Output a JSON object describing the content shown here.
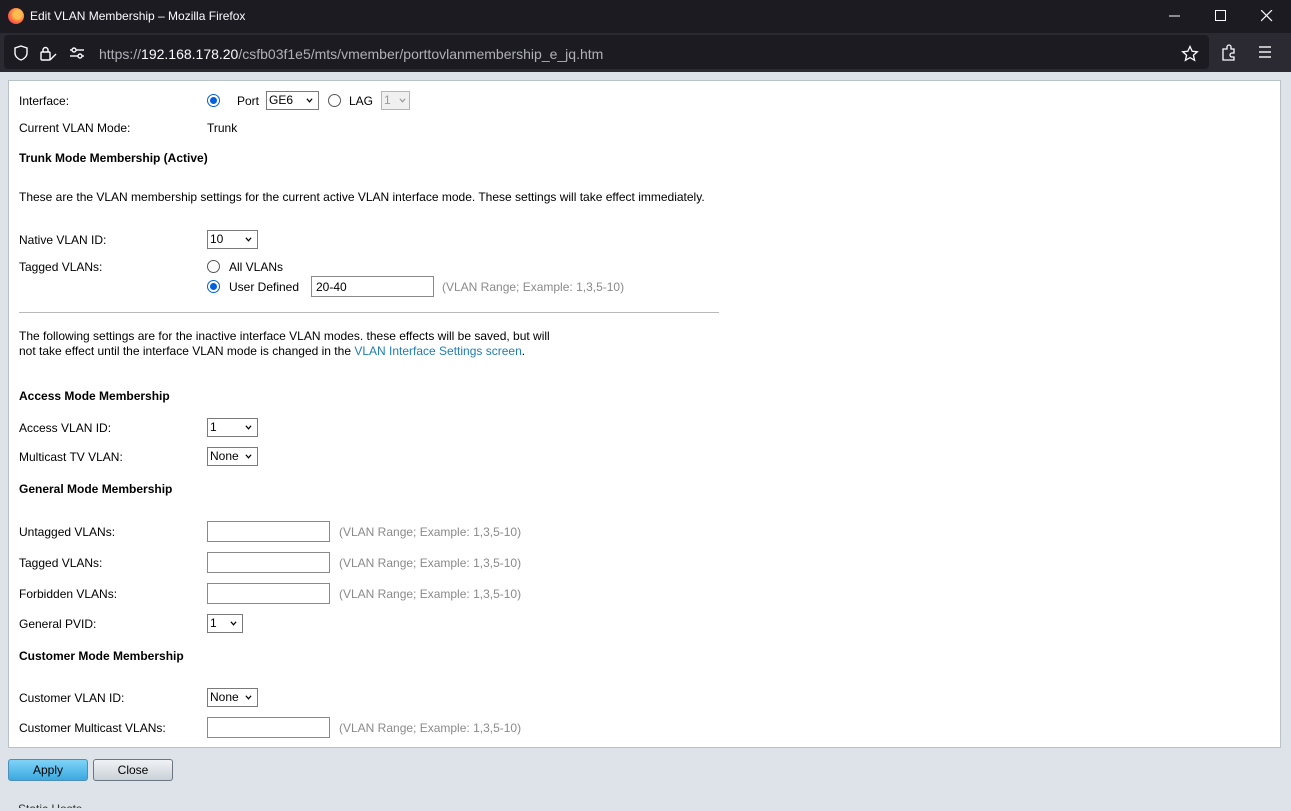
{
  "window": {
    "title": "Edit VLAN Membership – Mozilla Firefox"
  },
  "urlbar": {
    "url_prefix": "https://",
    "url_host": "192.168.178.20",
    "url_path": "/csfb03f1e5/mts/vmember/porttovlanmembership_e_jq.htm"
  },
  "form": {
    "interface_label": "Interface:",
    "port_label": "Port",
    "port_value": "GE6",
    "lag_label": "LAG",
    "lag_value": "1",
    "current_mode_label": "Current VLAN Mode:",
    "current_mode_value": "Trunk",
    "trunk": {
      "heading": "Trunk Mode Membership (Active)",
      "description": "These are the VLAN membership settings for the current active VLAN interface mode. These settings will take effect immediately.",
      "native_label": "Native VLAN ID:",
      "native_value": "10",
      "tagged_label": "Tagged VLANs:",
      "all_vlans_label": "All VLANs",
      "user_defined_label": "User Defined",
      "user_defined_value": "20-40",
      "range_hint": "(VLAN Range; Example: 1,3,5-10)"
    },
    "inactive_note_line1": "The following settings are for the inactive interface VLAN modes. these effects will be saved, but will",
    "inactive_note_line2_prefix": "not take effect until the interface VLAN mode is changed in the ",
    "inactive_note_link": "VLAN Interface Settings screen",
    "inactive_note_suffix": ".",
    "access": {
      "heading": "Access Mode Membership",
      "vlan_label": "Access VLAN ID:",
      "vlan_value": "1",
      "mtv_label": "Multicast TV VLAN:",
      "mtv_value": "None"
    },
    "general": {
      "heading": "General Mode Membership",
      "untagged_label": "Untagged VLANs:",
      "tagged_label": "Tagged VLANs:",
      "forbidden_label": "Forbidden VLANs:",
      "pvid_label": "General PVID:",
      "pvid_value": "1",
      "range_hint": "(VLAN Range; Example: 1,3,5-10)"
    },
    "customer": {
      "heading": "Customer Mode Membership",
      "vlan_label": "Customer VLAN ID:",
      "vlan_value": "None",
      "mcast_label": "Customer Multicast VLANs:",
      "range_hint": "(VLAN Range; Example: 1,3,5-10)"
    }
  },
  "buttons": {
    "apply": "Apply",
    "close": "Close"
  },
  "behind_text": "Static Hosts"
}
